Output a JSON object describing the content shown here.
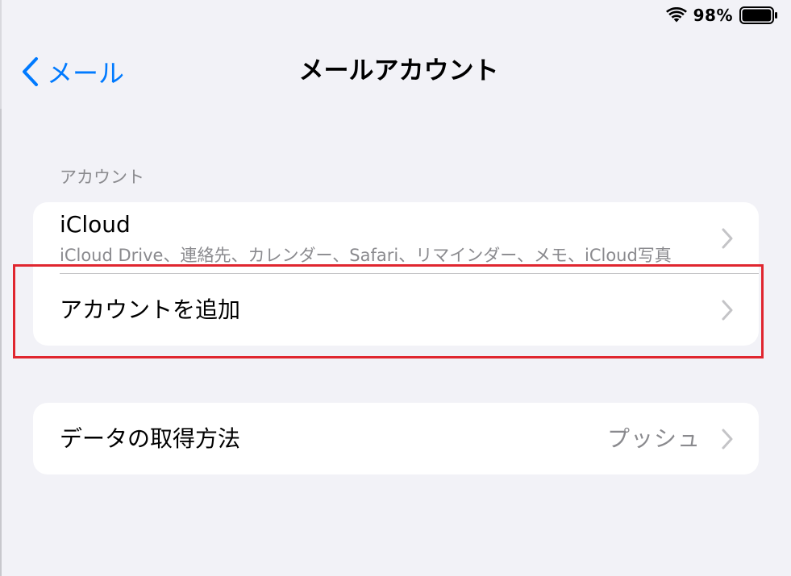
{
  "status_bar": {
    "battery_percent": "98%",
    "battery_level": 0.98,
    "icons": [
      "wifi-icon",
      "battery-icon"
    ]
  },
  "nav": {
    "back_label": "メール",
    "title": "メールアカウント",
    "accent_color": "#007aff"
  },
  "accounts_section": {
    "header": "アカウント",
    "items": [
      {
        "title": "iCloud",
        "subtitle": "iCloud Drive、連絡先、カレンダー、Safari、リマインダー、メモ、iCloud写真"
      },
      {
        "title": "アカウントを追加"
      }
    ]
  },
  "fetch_section": {
    "label": "データの取得方法",
    "value": "プッシュ"
  },
  "colors": {
    "background": "#f2f2f7",
    "secondary_text": "#8a8a8e",
    "highlight": "#e0262f"
  }
}
